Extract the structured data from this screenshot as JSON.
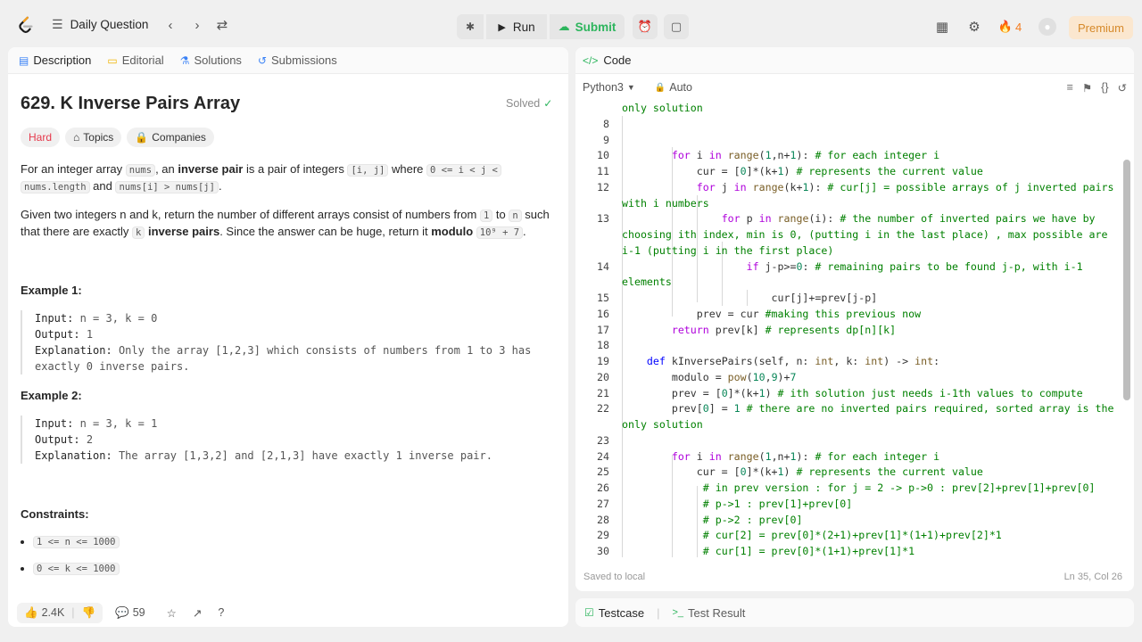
{
  "topbar": {
    "daily_label": "Daily Question",
    "run_label": "Run",
    "submit_label": "Submit",
    "streak_count": "4",
    "premium_label": "Premium"
  },
  "problem": {
    "tabs": [
      "Description",
      "Editorial",
      "Solutions",
      "Submissions"
    ],
    "title": "629. K Inverse Pairs Array",
    "solved_label": "Solved",
    "badges": {
      "difficulty": "Hard",
      "topics": "Topics",
      "companies": "Companies"
    },
    "para1": {
      "t1": "For an integer array ",
      "c1": "nums",
      "t2": ", an ",
      "b1": "inverse pair",
      "t3": " is a pair of integers ",
      "c2": "[i, j]",
      "t4": " where ",
      "c3": "0 <= i < j <",
      "c4": "nums.length",
      "t5": " and ",
      "c5": "nums[i] > nums[j]",
      "t6": "."
    },
    "para2": {
      "t1": "Given two integers n and k, return the number of different arrays consist of numbers from ",
      "c1": "1",
      "t2": " to ",
      "c2": "n",
      "t3": " such that there are exactly ",
      "c3": "k",
      "t4": " ",
      "b1": "inverse pairs",
      "t5": ". Since the answer can be huge, return it ",
      "b2": "modulo",
      "t6": " ",
      "c4": "10⁹ + 7",
      "t7": "."
    },
    "example1": {
      "heading": "Example 1:",
      "input_label": "Input:",
      "input": "n = 3, k = 0",
      "output_label": "Output:",
      "output": "1",
      "explanation_label": "Explanation:",
      "explanation": "Only the array [1,2,3] which consists of numbers from 1 to 3 has",
      "explanation2": "exactly 0 inverse pairs."
    },
    "example2": {
      "heading": "Example 2:",
      "input_label": "Input:",
      "input": "n = 3, k = 1",
      "output_label": "Output:",
      "output": "2",
      "explanation_label": "Explanation:",
      "explanation": "The array [1,3,2] and [2,1,3] have exactly 1 inverse pair."
    },
    "constraints_heading": "Constraints:",
    "constraints": [
      "1 <= n <= 1000",
      "0 <= k <= 1000"
    ],
    "footer": {
      "likes": "2.4K",
      "comments": "59"
    }
  },
  "editor": {
    "tab_label": "Code",
    "language": "Python3",
    "auto_label": "Auto",
    "status_left": "Saved to local",
    "status_right": "Ln 35, Col 26",
    "lines": [
      {
        "n": "",
        "t": "only solution"
      },
      {
        "n": "8",
        "t": ""
      },
      {
        "n": "9",
        "t": ""
      },
      {
        "n": "10",
        "t": "        for i in range(1,n+1): # for each integer i"
      },
      {
        "n": "11",
        "t": "            cur = [0]*(k+1) # represents the current value"
      },
      {
        "n": "12",
        "t": "            for j in range(k+1): # cur[j] = possible arrays of j inverted pairs"
      },
      {
        "n": "",
        "t": "with i numbers"
      },
      {
        "n": "13",
        "t": "                for p in range(i): # the number of inverted pairs we have by"
      },
      {
        "n": "",
        "t": "choosing ith index, min is 0, (putting i in the last place) , max possible are"
      },
      {
        "n": "",
        "t": "i-1 (putting i in the first place)"
      },
      {
        "n": "14",
        "t": "                    if j-p>=0: # remaining pairs to be found j-p, with i-1"
      },
      {
        "n": "",
        "t": "elements"
      },
      {
        "n": "15",
        "t": "                        cur[j]+=prev[j-p]"
      },
      {
        "n": "16",
        "t": "            prev = cur #making this previous now"
      },
      {
        "n": "17",
        "t": "        return prev[k] # represents dp[n][k]"
      },
      {
        "n": "18",
        "t": ""
      },
      {
        "n": "19",
        "t": "    def kInversePairs(self, n: int, k: int) -> int:"
      },
      {
        "n": "20",
        "t": "        modulo = pow(10,9)+7"
      },
      {
        "n": "21",
        "t": "        prev = [0]*(k+1) # ith solution just needs i-1th values to compute"
      },
      {
        "n": "22",
        "t": "        prev[0] = 1 # there are no inverted pairs required, sorted array is the"
      },
      {
        "n": "",
        "t": "only solution"
      },
      {
        "n": "23",
        "t": ""
      },
      {
        "n": "24",
        "t": "        for i in range(1,n+1): # for each integer i"
      },
      {
        "n": "25",
        "t": "            cur = [0]*(k+1) # represents the current value"
      },
      {
        "n": "26",
        "t": "             # in prev version : for j = 2 -> p->0 : prev[2]+prev[1]+prev[0]"
      },
      {
        "n": "27",
        "t": "             # p->1 : prev[1]+prev[0]"
      },
      {
        "n": "28",
        "t": "             # p->2 : prev[0]"
      },
      {
        "n": "29",
        "t": "             # cur[2] = prev[0]*(2+1)+prev[1]*(1+1)+prev[2]*1"
      },
      {
        "n": "30",
        "t": "             # cur[1] = prev[0]*(1+1)+prev[1]*1"
      }
    ]
  },
  "bottom": {
    "testcase_label": "Testcase",
    "result_label": "Test Result"
  },
  "colors": {
    "accent_green": "#2db55d",
    "hard_red": "#e5384b",
    "premium": "#d68a2c"
  }
}
